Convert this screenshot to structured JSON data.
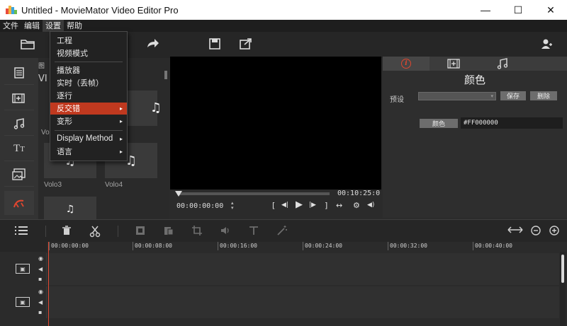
{
  "window": {
    "title": "Untitled - MovieMator Video Editor Pro",
    "minimize": "—",
    "maximize": "☐",
    "close": "✕"
  },
  "menubar": [
    "文件",
    "编辑",
    "设置",
    "帮助"
  ],
  "settings_menu": {
    "items": [
      {
        "label": "工程",
        "submenu": false
      },
      {
        "label": "视频模式",
        "submenu": false
      },
      {
        "label": "播放器",
        "submenu": false
      },
      {
        "label": "实时（丢帧）",
        "submenu": false
      },
      {
        "label": "逐行",
        "submenu": false
      },
      {
        "label": "反交错",
        "submenu": true,
        "highlighted": true
      },
      {
        "label": "变形",
        "submenu": true
      },
      {
        "label": "Display Method",
        "submenu": true
      },
      {
        "label": "语言",
        "submenu": true
      }
    ],
    "submenu_arrow": "▸"
  },
  "media": {
    "header_fragment": "图",
    "title_fragment": "VI",
    "thumb_glyph": "♫",
    "labels": [
      "Volo3",
      "Volo4"
    ],
    "partial_label": "Vo"
  },
  "preview": {
    "total_time": "00:10:25:0",
    "current_time": "00:00:00:00",
    "controls": {
      "mark_in": "[",
      "prev": "◀|",
      "play": "▶",
      "next": "|▶",
      "mark_out": "]",
      "fit": "↔",
      "settings": "⚙",
      "volume": "◀)"
    }
  },
  "right_panel": {
    "title": "颜色",
    "preset_label": "预设",
    "save_button": "保存",
    "delete_button": "删除",
    "color_button": "颜色",
    "color_value": "#FF000000",
    "select_caret": "▾"
  },
  "timeline": {
    "ticks": [
      "00:00:00:00",
      "00:00:08:00",
      "00:00:16:00",
      "00:00:24:00",
      "00:00:32:00",
      "00:00:40:00"
    ],
    "track_symbols": {
      "eye": "👁",
      "audio": "◀",
      "lock": "🔒",
      "film": "▣"
    }
  },
  "colors": {
    "accent": "#e0462f",
    "menu_highlight": "#c0391f",
    "preview_bg": "#000000",
    "panel_bg": "#2b2b2b"
  }
}
